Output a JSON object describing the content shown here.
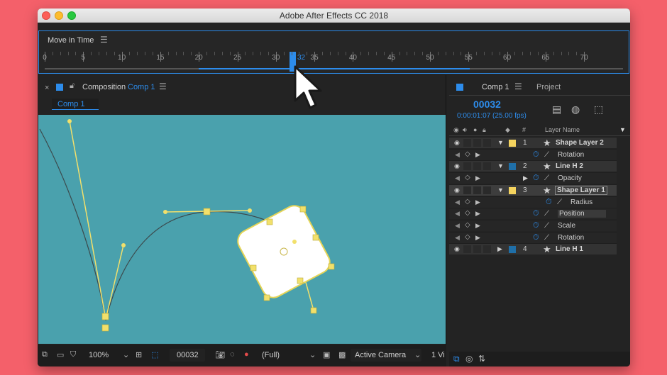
{
  "window": {
    "title": "Adobe After Effects CC 2018"
  },
  "timenav": {
    "title": "Move in Time",
    "ticks": [
      "0",
      "5",
      "10",
      "15",
      "20",
      "25",
      "30",
      "35",
      "40",
      "45",
      "50",
      "55",
      "60",
      "65",
      "70"
    ],
    "current_frame_label": "32"
  },
  "composition": {
    "tab_label": "Composition",
    "tab_name": "Comp 1",
    "subtab": "Comp 1",
    "toolbar": {
      "zoom": "100%",
      "frame": "00032",
      "resolution": "(Full)",
      "camera": "Active Camera",
      "views": "1 Vi"
    }
  },
  "timeline": {
    "tab_name": "Comp 1",
    "project_tab": "Project",
    "timecode": "00032",
    "timecode_sub": "0:00:01:07 (25.00 fps)",
    "column_hash": "#",
    "column_layer_name": "Layer Name",
    "rows": [
      {
        "kind": "layer",
        "num": "1",
        "name": "Shape Layer 2",
        "label_color": "#f4d35e",
        "expanded": true
      },
      {
        "kind": "prop",
        "name": "Rotation",
        "indent": 0
      },
      {
        "kind": "layer",
        "num": "2",
        "name": "Line H 2",
        "label_color": "#1f6fa8",
        "expanded": true
      },
      {
        "kind": "prop",
        "name": "Opacity",
        "indent": 0,
        "twirl": true
      },
      {
        "kind": "layer",
        "num": "3",
        "name": "Shape Layer 1",
        "label_color": "#f4d35e",
        "expanded": true,
        "selected": true
      },
      {
        "kind": "prop",
        "name": "Radius",
        "indent": 1
      },
      {
        "kind": "prop",
        "name": "Position",
        "indent": 0,
        "highlight": true
      },
      {
        "kind": "prop",
        "name": "Scale",
        "indent": 0
      },
      {
        "kind": "prop",
        "name": "Rotation",
        "indent": 0
      },
      {
        "kind": "layer",
        "num": "4",
        "name": "Line H 1",
        "label_color": "#1f6fa8",
        "expanded": false
      }
    ]
  },
  "colors": {
    "accent": "#2d8ceb",
    "viewer_bg": "#4aa1ad",
    "path_yellow": "#f2e06b",
    "page_bg": "#f4606a"
  }
}
